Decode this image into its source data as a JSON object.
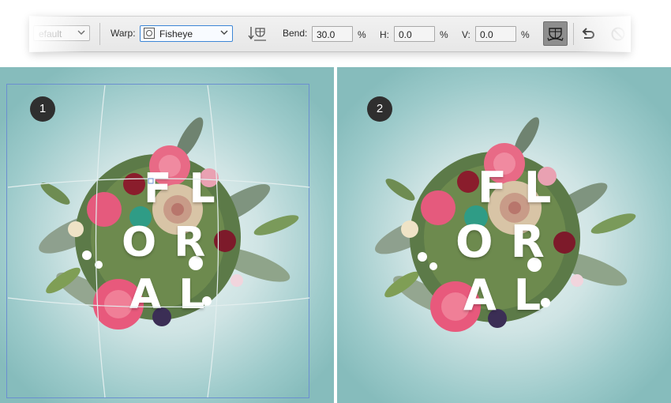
{
  "toolbar": {
    "preset_value": "efault",
    "warp_label": "Warp:",
    "warp_value": "Fisheye",
    "bend_label": "Bend:",
    "bend_value": "30.0",
    "h_label": "H:",
    "h_value": "0.0",
    "v_label": "V:",
    "v_value": "0.0",
    "percent": "%",
    "icons": [
      "chevron-down-icon",
      "warp-style-icon",
      "change-orientation-icon",
      "split-warp-icon",
      "undo-icon",
      "cancel-icon"
    ]
  },
  "panels": [
    {
      "step": "1",
      "word_lines": [
        "FL",
        "OR",
        "AL"
      ],
      "transform_grid_visible": true
    },
    {
      "step": "2",
      "word_lines": [
        "FL",
        "OR",
        "AL"
      ],
      "transform_grid_visible": false
    }
  ],
  "colors": {
    "background_center": "#f1f7f7",
    "background_edge": "#86bcbc",
    "badge": "#2f2f2f",
    "grid_line": "#6b8fd0",
    "selected_field_border": "#3d86d6"
  }
}
